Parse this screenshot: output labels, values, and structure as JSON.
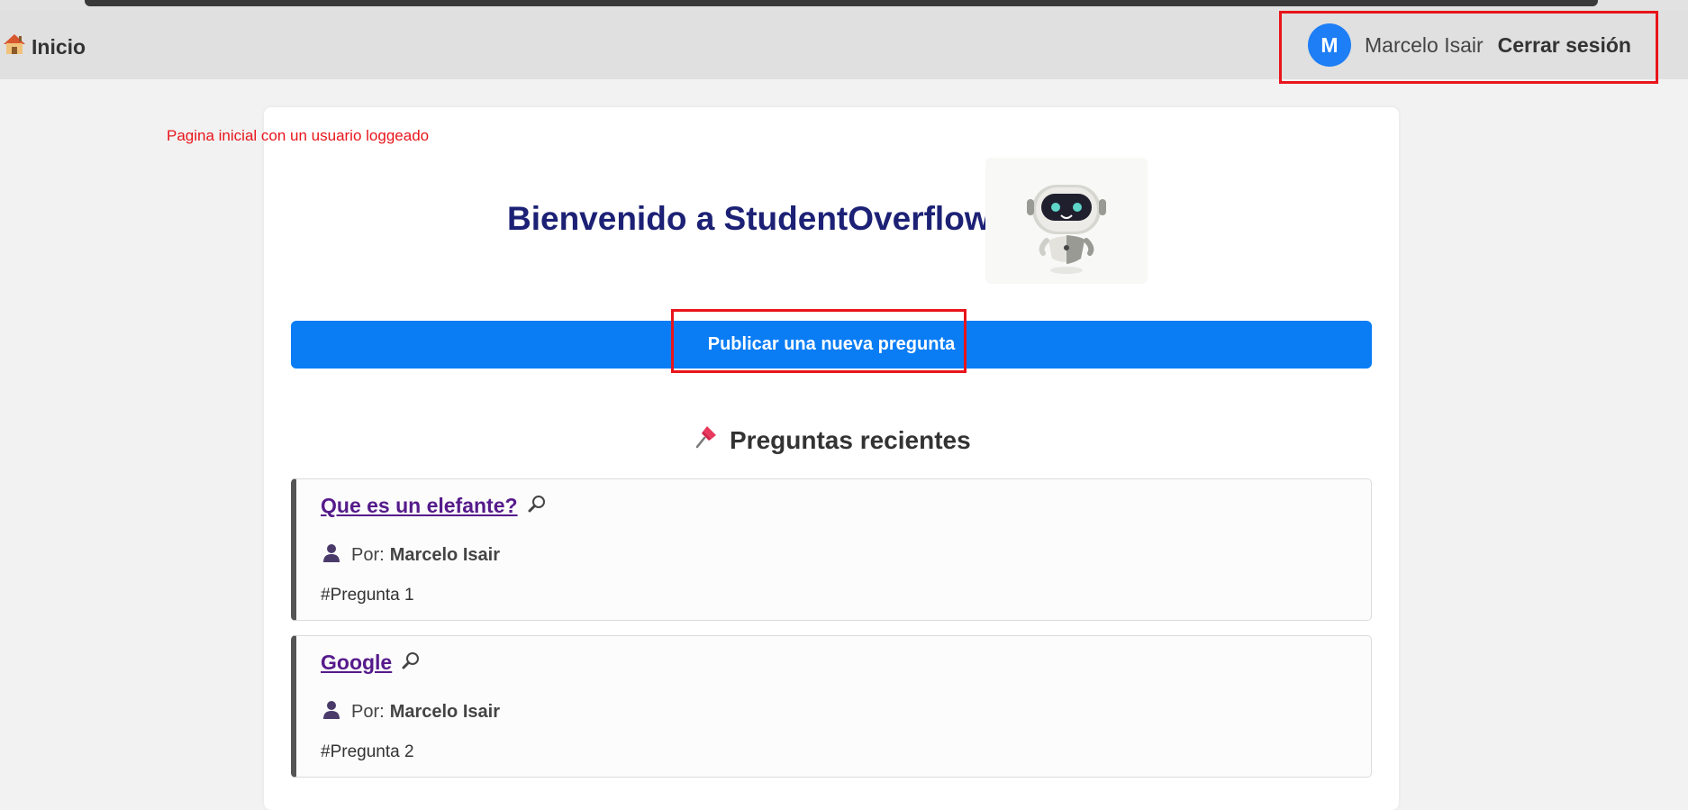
{
  "navbar": {
    "home_label": "Inicio",
    "user_initial": "M",
    "user_name": "Marcelo Isair",
    "logout_label": "Cerrar sesión"
  },
  "annotation": "Pagina inicial con un usuario loggeado",
  "main": {
    "welcome_title": "Bienvenido a StudentOverflow",
    "publish_label": "Publicar una nueva pregunta",
    "recent_title": "Preguntas recientes"
  },
  "questions": [
    {
      "title": "Que es un elefante?",
      "by_label": "Por:",
      "author": "Marcelo Isair",
      "number": "#Pregunta 1"
    },
    {
      "title": "Google",
      "by_label": "Por:",
      "author": "Marcelo Isair",
      "number": "#Pregunta 2"
    }
  ],
  "icons": {
    "home": "house-icon",
    "pin": "pushpin-icon",
    "search": "magnifier-icon",
    "user": "user-silhouette-icon",
    "robot": "robot-mascot"
  },
  "colors": {
    "accent": "#0a7df5",
    "title": "#1c2175",
    "link": "#551a8b",
    "annotation": "#e8151b"
  }
}
